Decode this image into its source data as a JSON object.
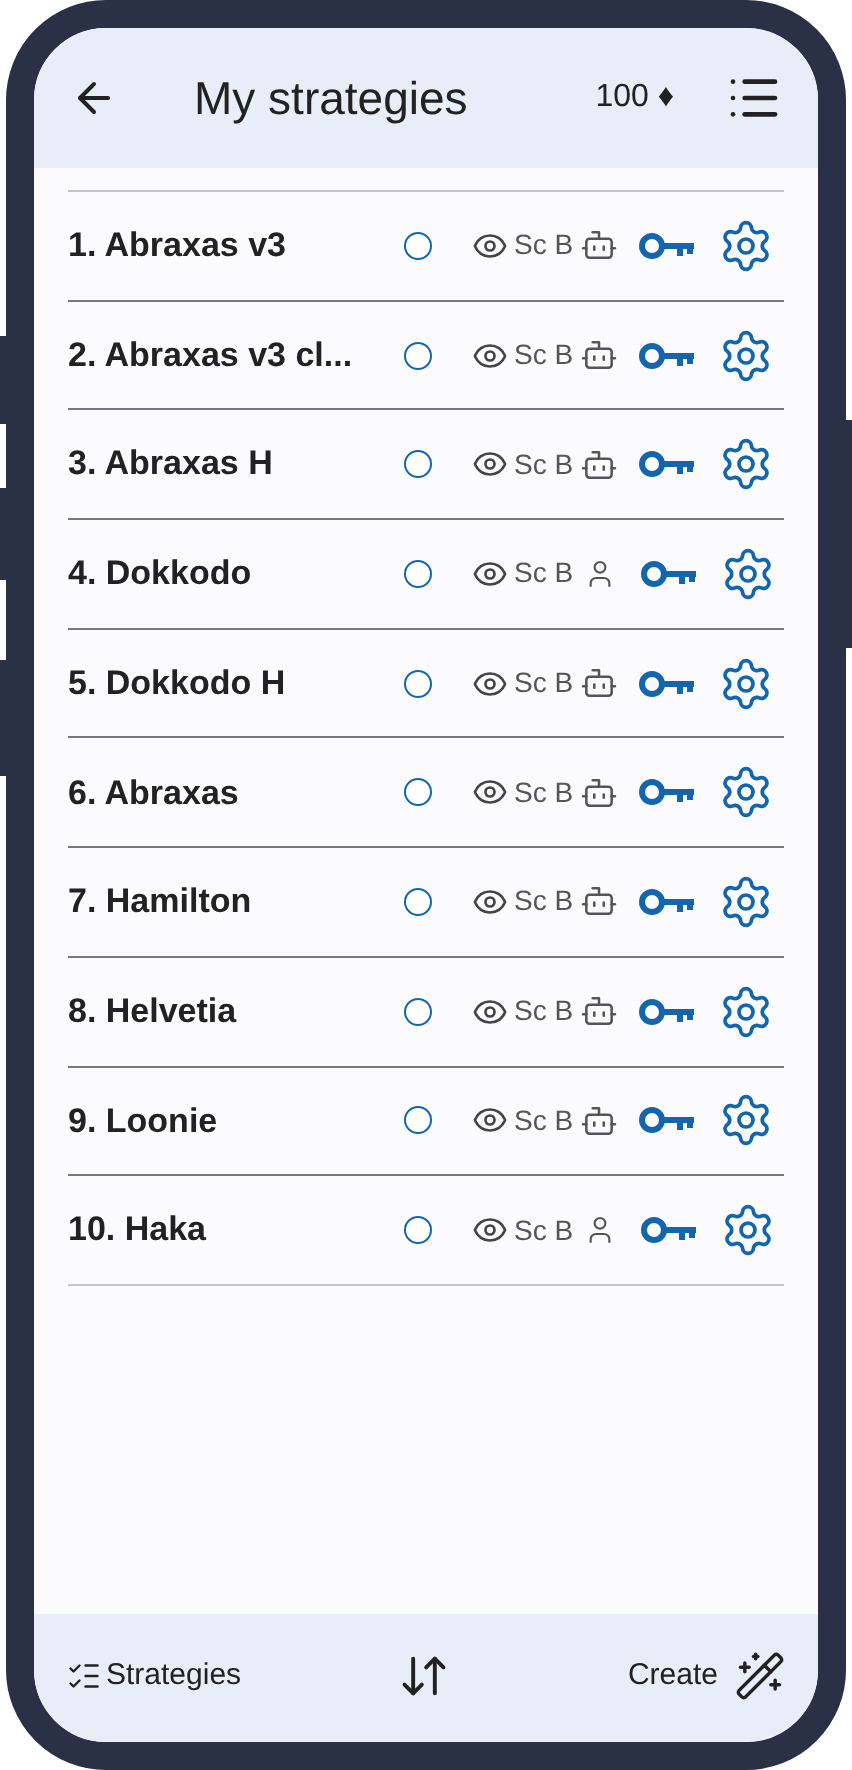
{
  "header": {
    "title": "My strategies",
    "credits": "100 ♦"
  },
  "strategies": [
    {
      "name": "1. Abraxas v3",
      "selected": false,
      "visibility": "Sc B",
      "kind": "bot"
    },
    {
      "name": "2. Abraxas v3 cl...",
      "selected": false,
      "visibility": "Sc B",
      "kind": "bot"
    },
    {
      "name": "3. Abraxas H",
      "selected": false,
      "visibility": "Sc B",
      "kind": "bot"
    },
    {
      "name": "4. Dokkodo",
      "selected": false,
      "visibility": "Sc B",
      "kind": "human"
    },
    {
      "name": "5. Dokkodo H",
      "selected": false,
      "visibility": "Sc B",
      "kind": "bot"
    },
    {
      "name": "6. Abraxas",
      "selected": false,
      "visibility": "Sc B",
      "kind": "bot"
    },
    {
      "name": "7. Hamilton",
      "selected": false,
      "visibility": "Sc B",
      "kind": "bot"
    },
    {
      "name": "8. Helvetia",
      "selected": false,
      "visibility": "Sc B",
      "kind": "bot"
    },
    {
      "name": "9. Loonie",
      "selected": false,
      "visibility": "Sc B",
      "kind": "bot"
    },
    {
      "name": "10. Haka",
      "selected": false,
      "visibility": "Sc B",
      "kind": "human"
    }
  ],
  "footer": {
    "strategies": "Strategies",
    "create": "Create"
  }
}
